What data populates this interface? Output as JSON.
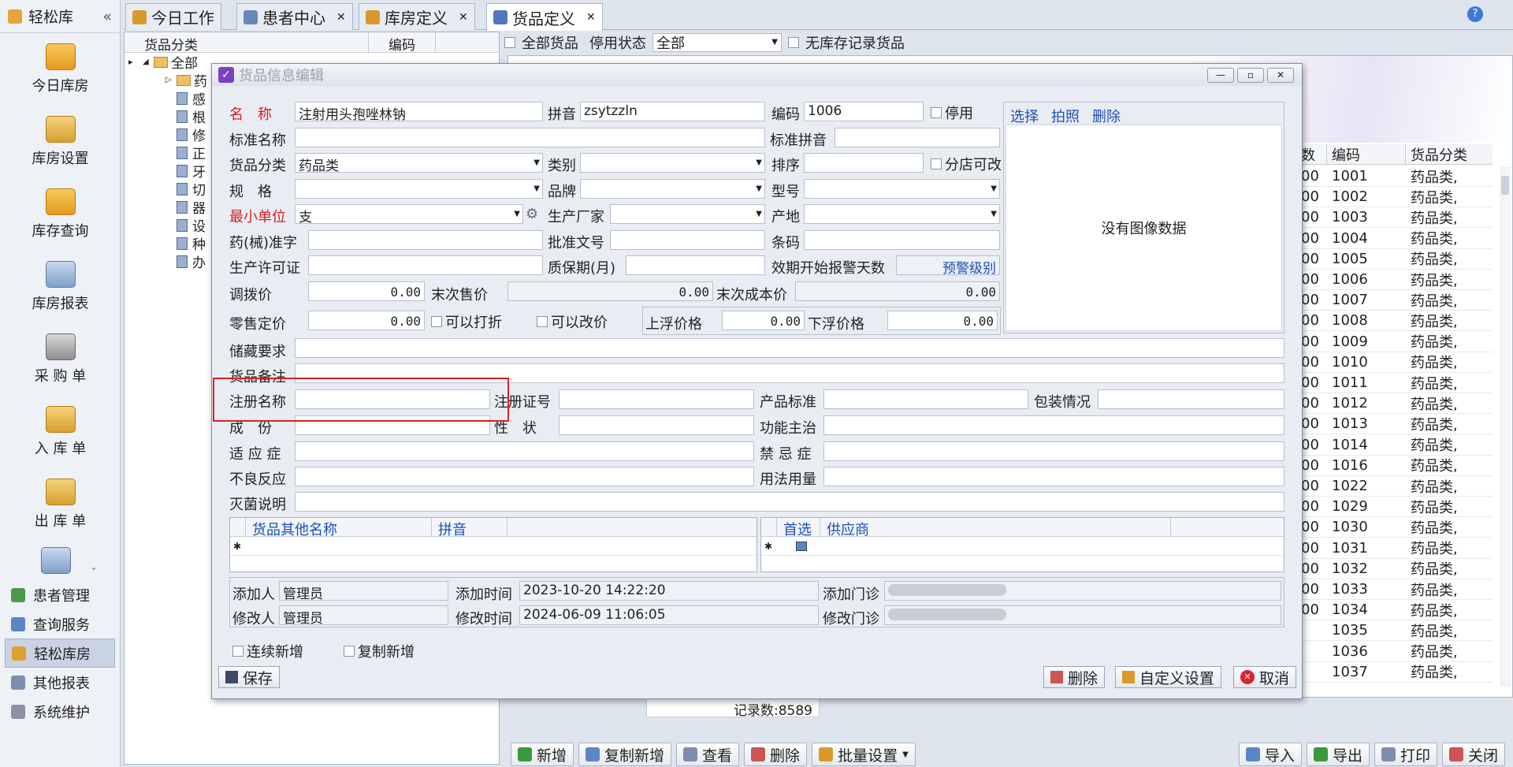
{
  "sidebar": {
    "title": "轻松库",
    "collapse": "«",
    "big": [
      "今日库房",
      "库房设置",
      "库存查询",
      "库房报表",
      "采 购 单",
      "入 库 单",
      "出 库 单"
    ],
    "small": [
      "患者管理",
      "查询服务",
      "轻松库房",
      "其他报表",
      "系统维护"
    ]
  },
  "tabs": [
    {
      "label": "今日工作"
    },
    {
      "label": "患者中心"
    },
    {
      "label": "库房定义"
    },
    {
      "label": "货品定义"
    }
  ],
  "tree": {
    "headers": [
      "货品分类",
      "编码"
    ],
    "root": "全部",
    "items": [
      "药",
      "感",
      "根",
      "修",
      "正",
      "牙",
      "切",
      "器",
      "设",
      "种",
      "办"
    ]
  },
  "filter": {
    "all_goods": "全部货品",
    "status_label": "停用状态",
    "status_value": "全部",
    "no_stock": "无库存记录货品"
  },
  "grid": {
    "headers": [
      "数",
      "编码",
      "货品分类"
    ],
    "rows": [
      [
        "00",
        "1001",
        "药品类,"
      ],
      [
        "00",
        "1002",
        "药品类,"
      ],
      [
        "00",
        "1003",
        "药品类,"
      ],
      [
        "00",
        "1004",
        "药品类,"
      ],
      [
        "00",
        "1005",
        "药品类,"
      ],
      [
        "00",
        "1006",
        "药品类,"
      ],
      [
        "00",
        "1007",
        "药品类,"
      ],
      [
        "00",
        "1008",
        "药品类,"
      ],
      [
        "00",
        "1009",
        "药品类,"
      ],
      [
        "00",
        "1010",
        "药品类,"
      ],
      [
        "00",
        "1011",
        "药品类,"
      ],
      [
        "00",
        "1012",
        "药品类,"
      ],
      [
        "00",
        "1013",
        "药品类,"
      ],
      [
        "00",
        "1014",
        "药品类,"
      ],
      [
        "00",
        "1016",
        "药品类,"
      ],
      [
        "00",
        "1022",
        "药品类,"
      ],
      [
        "00",
        "1029",
        "药品类,"
      ],
      [
        "00",
        "1030",
        "药品类,"
      ],
      [
        "00",
        "1031",
        "药品类,"
      ],
      [
        "00",
        "1032",
        "药品类,"
      ],
      [
        "00",
        "1033",
        "药品类,"
      ],
      [
        "00",
        "1034",
        "药品类,"
      ],
      [
        "",
        "1035",
        "药品类,"
      ],
      [
        "",
        "1036",
        "药品类,"
      ],
      [
        "",
        "1037",
        "药品类,"
      ]
    ],
    "records": "记录数:8589"
  },
  "toolbar": [
    "新增",
    "复制新增",
    "查看",
    "删除",
    "批量设置",
    "导入",
    "导出",
    "打印",
    "关闭"
  ],
  "dialog": {
    "title": "货品信息编辑",
    "name_label": "名　称",
    "name_value": "注射用头孢唑林钠",
    "pinyin_label": "拼音",
    "pinyin_value": "zsytzzln",
    "code_label": "编码",
    "code_value": "1006",
    "disable": "停用",
    "std_name": "标准名称",
    "std_pinyin": "标准拼音",
    "category_label": "货品分类",
    "category_value": "药品类",
    "type_label": "类别",
    "sort_label": "排序",
    "branch_edit": "分店可改",
    "spec_label": "规　格",
    "brand_label": "品牌",
    "model_label": "型号",
    "unit_label": "最小单位",
    "unit_value": "支",
    "maker_label": "生产厂家",
    "origin_label": "产地",
    "approval_label": "药(械)准字",
    "batch_label": "批准文号",
    "barcode_label": "条码",
    "license_label": "生产许可证",
    "shelf_label": "质保期(月)",
    "expire_label": "效期开始报警天数",
    "warn_level": "预警级别",
    "transfer_label": "调拨价",
    "transfer_value": "0.00",
    "last_sale_label": "末次售价",
    "last_sale_value": "0.00",
    "last_cost_label": "末次成本价",
    "last_cost_value": "0.00",
    "retail_label": "零售定价",
    "retail_value": "0.00",
    "discount": "可以打折",
    "change_price": "可以改价",
    "up_label": "上浮价格",
    "up_value": "0.00",
    "down_label": "下浮价格",
    "down_value": "0.00",
    "storage": "储藏要求",
    "remark": "货品备注",
    "reg_name": "注册名称",
    "reg_no": "注册证号",
    "product_std": "产品标准",
    "packing": "包装情况",
    "ingredient": "成　份",
    "character": "性　状",
    "function": "功能主治",
    "indication": "适 应 症",
    "taboo": "禁 忌 症",
    "adverse": "不良反应",
    "usage": "用法用量",
    "steril": "灭菌说明",
    "other_name_hdr": "货品其他名称",
    "other_pinyin_hdr": "拼音",
    "pref_hdr": "首选",
    "supplier_hdr": "供应商",
    "add_by_label": "添加人",
    "add_by": "管理员",
    "add_time_label": "添加时间",
    "add_time": "2023-10-20 14:22:20",
    "add_clinic_label": "添加门诊",
    "mod_by_label": "修改人",
    "mod_by": "管理员",
    "mod_time_label": "修改时间",
    "mod_time": "2024-06-09 11:06:05",
    "mod_clinic_label": "修改门诊",
    "cont_add": "连续新增",
    "copy_add": "复制新增",
    "save": "保存",
    "delete": "删除",
    "custom": "自定义设置",
    "cancel": "取消",
    "img_select": "选择",
    "img_photo": "拍照",
    "img_delete": "删除",
    "no_image": "没有图像数据"
  }
}
